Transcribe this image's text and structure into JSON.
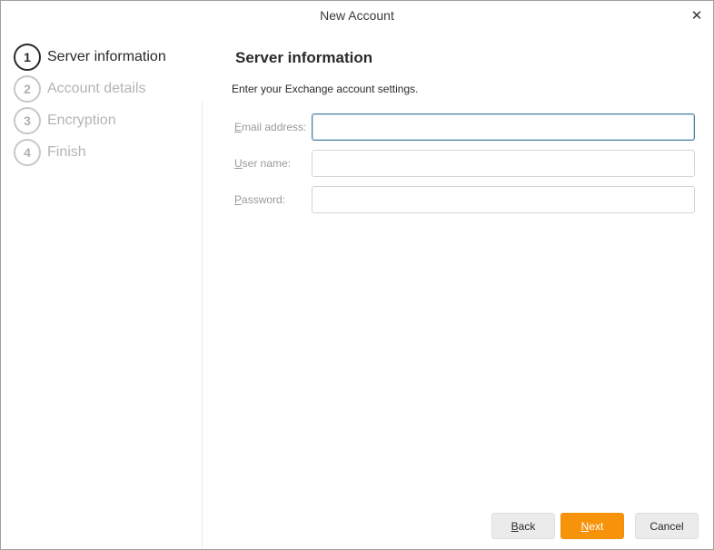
{
  "window": {
    "title": "New Account",
    "close_glyph": "✕"
  },
  "steps": [
    {
      "number": "1",
      "label": "Server information",
      "active": true
    },
    {
      "number": "2",
      "label": "Account details",
      "active": false
    },
    {
      "number": "3",
      "label": "Encryption",
      "active": false
    },
    {
      "number": "4",
      "label": "Finish",
      "active": false
    }
  ],
  "main": {
    "title": "Server information",
    "instructions": "Enter your Exchange account settings.",
    "fields": {
      "email": {
        "label_mnemonic": "E",
        "label_rest": "mail address:",
        "value": "",
        "placeholder": ""
      },
      "username": {
        "label_mnemonic": "U",
        "label_rest": "ser name:",
        "value": "",
        "placeholder": ""
      },
      "password": {
        "label_mnemonic": "P",
        "label_rest": "assword:",
        "value": "",
        "placeholder": ""
      }
    }
  },
  "buttons": {
    "back": {
      "mnemonic": "B",
      "rest": "ack"
    },
    "next": {
      "mnemonic": "N",
      "rest": "ext"
    },
    "cancel": {
      "label": "Cancel"
    }
  },
  "colors": {
    "accent": "#f7930b",
    "focus_border": "#4a7ea0"
  }
}
